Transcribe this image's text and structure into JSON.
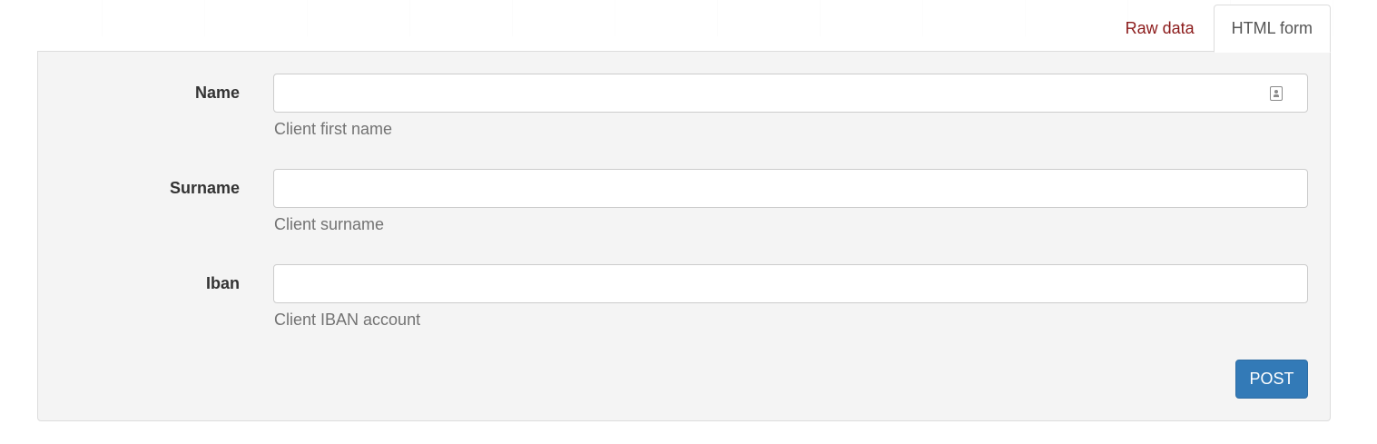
{
  "tabs": {
    "raw_data": "Raw data",
    "html_form": "HTML form",
    "active": "HTML form"
  },
  "form": {
    "fields": [
      {
        "label": "Name",
        "value": "",
        "help": "Client first name"
      },
      {
        "label": "Surname",
        "value": "",
        "help": "Client surname"
      },
      {
        "label": "Iban",
        "value": "",
        "help": "Client IBAN account"
      }
    ],
    "submit_label": "POST"
  },
  "icons": {
    "autofill": "contact-card-icon"
  },
  "colors": {
    "panel_bg": "#f4f4f4",
    "tab_link": "#8b1a1a",
    "primary_button": "#337ab7"
  }
}
